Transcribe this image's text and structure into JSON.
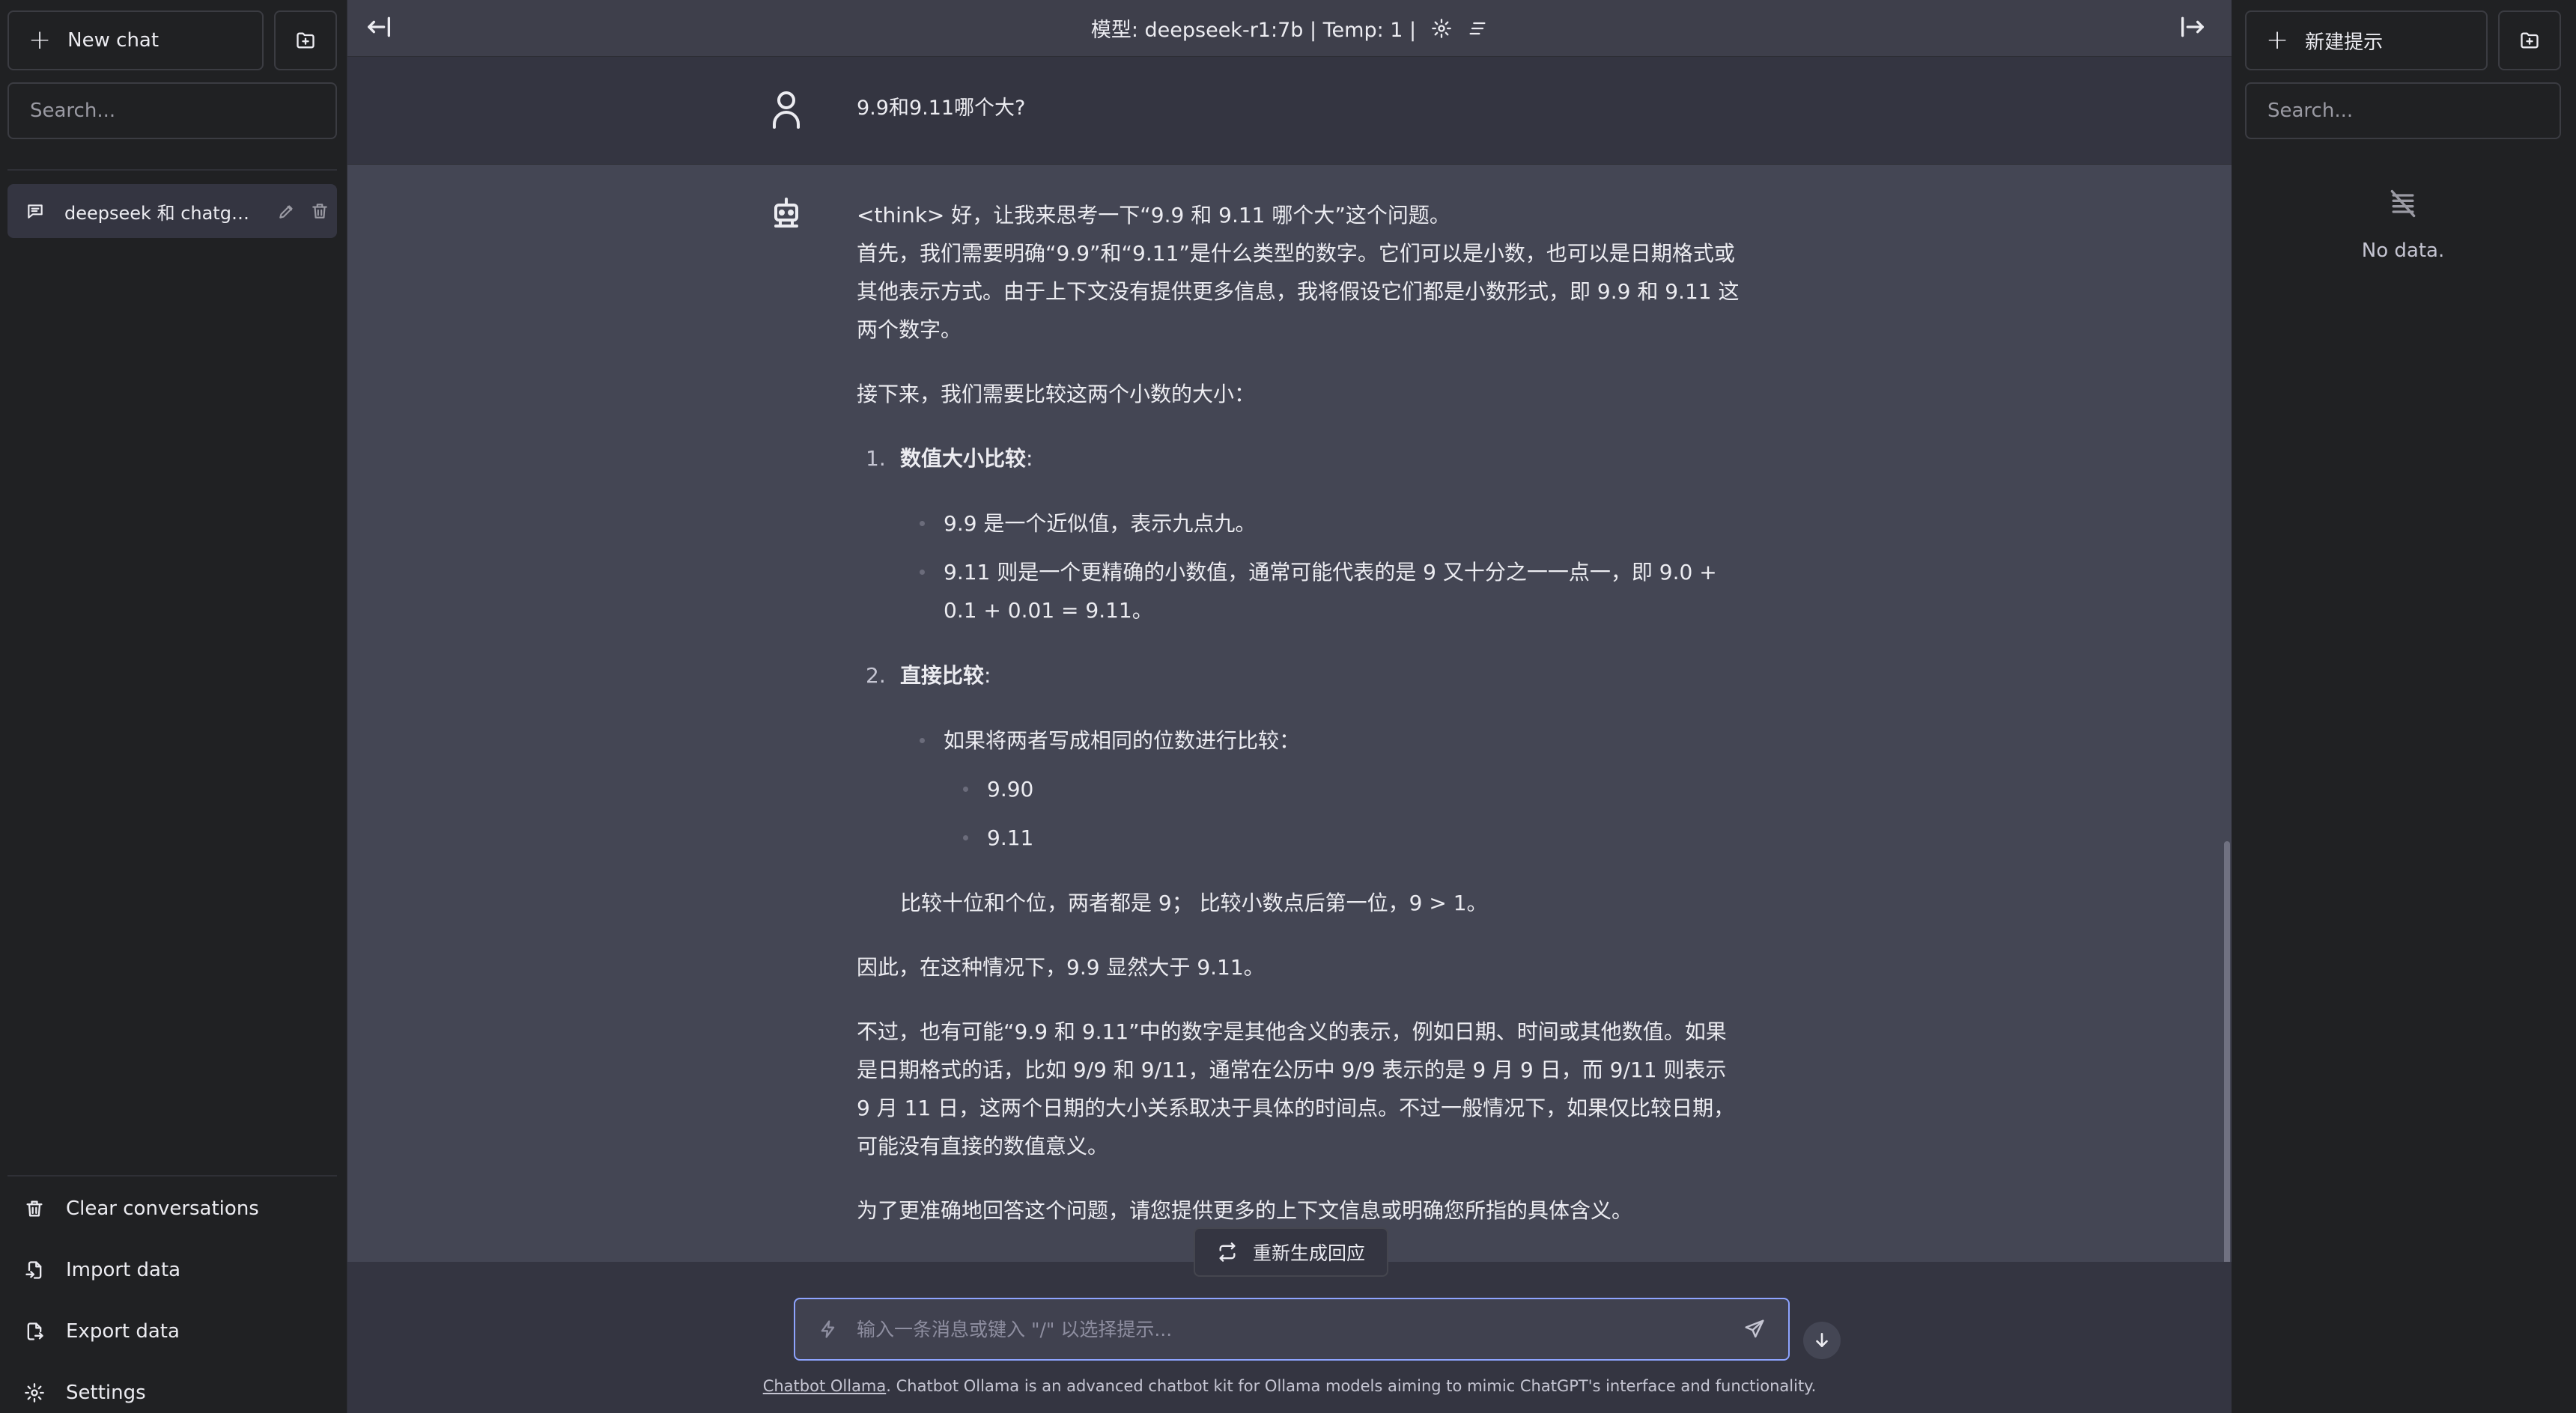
{
  "sidebar": {
    "new_chat_label": "New chat",
    "search_placeholder": "Search...",
    "conversations": [
      {
        "title": "deepseek 和 chatgpt ..."
      }
    ],
    "footer": {
      "clear": "Clear conversations",
      "import": "Import data",
      "export": "Export data",
      "settings": "Settings"
    }
  },
  "header": {
    "model_info": "模型: deepseek-r1:7b | Temp: 1 |"
  },
  "chat": {
    "user_message": "9.9和9.11哪个大?",
    "assistant": {
      "p1": "<think> 好，让我来思考一下“9.9 和 9.11 哪个大”这个问题。",
      "p2": "首先，我们需要明确“9.9”和“9.11”是什么类型的数字。它们可以是小数，也可以是日期格式或其他表示方式。由于上下文没有提供更多信息，我将假设它们都是小数形式，即 9.9 和 9.11 这两个数字。",
      "p3": "接下来，我们需要比较这两个小数的大小：",
      "item1_num": "1.",
      "item1_title": "数值大小比较",
      "item1_b1": "9.9 是一个近似值，表示九点九。",
      "item1_b2": "9.11 则是一个更精确的小数值，通常可能代表的是 9 又十分之一一点一，即 9.0 + 0.1 + 0.01 = 9.11。",
      "item2_num": "2.",
      "item2_title": "直接比较",
      "item2_b1": "如果将两者写成相同的位数进行比较：",
      "item2_sub1": "9.90",
      "item2_sub2": "9.11",
      "item2_note": "比较十位和个位，两者都是 9； 比较小数点后第一位，9 > 1。",
      "p4": "因此，在这种情况下，9.9 显然大于 9.11。",
      "p5": "不过，也有可能“9.9 和 9.11”中的数字是其他含义的表示，例如日期、时间或其他数值。如果是日期格式的话，比如 9/9 和 9/11，通常在公历中 9/9 表示的是 9 月 9 日，而 9/11 则表示 9 月 11 日，这两个日期的大小关系取决于具体的时间点。不过一般情况下，如果仅比较日期，可能没有直接的数值意义。",
      "p6": "为了更准确地回答这个问题，请您提供更多的上下文信息或明确您所指的具体含义。"
    },
    "regenerate_label": "重新生成回应",
    "input_placeholder": "输入一条消息或键入 \"/\" 以选择提示...",
    "disclaimer_link": "Chatbot Ollama",
    "disclaimer_text": ". Chatbot Ollama is an advanced chatbot kit for Ollama models aiming to mimic ChatGPT's interface and functionality."
  },
  "prompts": {
    "new_prompt_label": "新建提示",
    "search_placeholder": "Search...",
    "empty_text": "No data."
  },
  "colors": {
    "sidebar_bg": "#202123",
    "main_bg": "#444654",
    "user_row_bg": "#343541",
    "input_focus_border": "#8ea4ff"
  },
  "icons": {
    "new_chat": "plus-icon",
    "new_folder": "folder-plus-icon",
    "conversation": "message-icon",
    "edit": "pencil-icon",
    "delete": "trash-icon",
    "import": "file-import-icon",
    "export": "file-export-icon",
    "settings": "gear-icon",
    "toggle_left": "arrow-bar-left-icon",
    "toggle_right": "arrow-bar-right-icon",
    "user_avatar": "user-icon",
    "bot_avatar": "robot-icon",
    "regenerate": "refresh-icon",
    "bolt": "bolt-icon",
    "send": "send-icon",
    "scroll_down": "arrow-down-icon",
    "no_data": "database-off-icon"
  }
}
